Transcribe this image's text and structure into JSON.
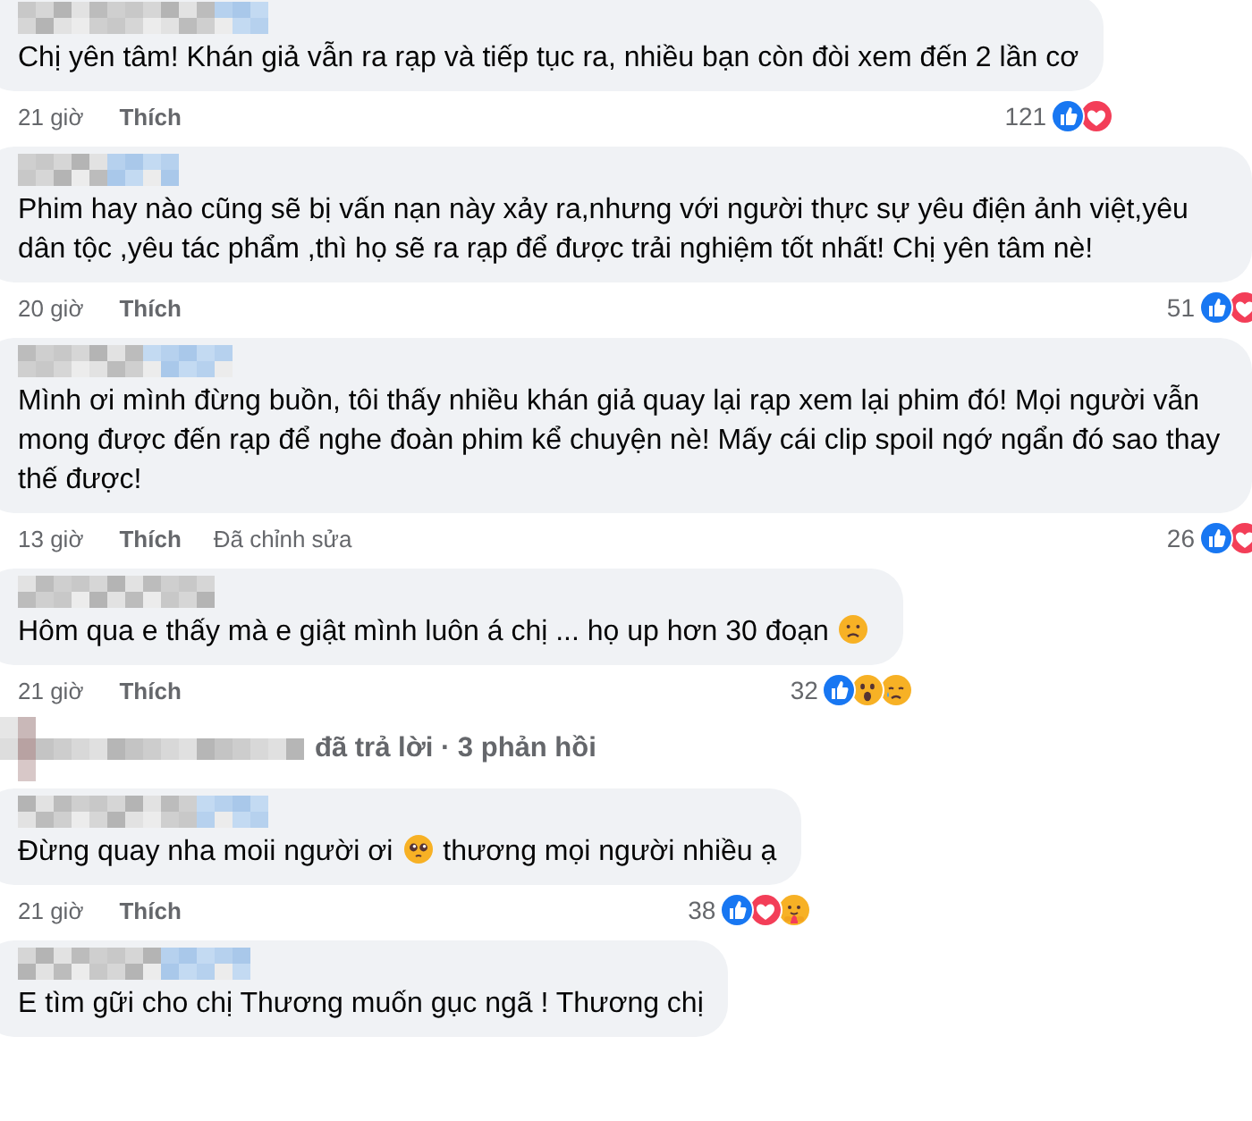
{
  "comments": [
    {
      "body": [
        {
          "kind": "text",
          "text": "Chị yên tâm! Khán giả vẫn ra rạp và tiếp tục ra, nhiều bạn còn đòi xem đến 2 lần cơ"
        }
      ],
      "time": "21 giờ",
      "like_label": "Thích",
      "reaction_count": "121",
      "reactions": [
        {
          "kind": "like"
        },
        {
          "kind": "love"
        }
      ]
    },
    {
      "body": [
        {
          "kind": "text",
          "text": "Phim hay nào cũng sẽ bị vấn nạn này xảy ra,nhưng với người thực sự yêu điện ảnh việt,yêu dân tộc ,yêu tác phẩm ,thì họ sẽ ra rạp để được trải nghiệm tốt nhất! Chị yên tâm nè!"
        }
      ],
      "time": "20 giờ",
      "like_label": "Thích",
      "reaction_count": "51",
      "reactions": [
        {
          "kind": "like"
        },
        {
          "kind": "love"
        }
      ]
    },
    {
      "body": [
        {
          "kind": "text",
          "text": "Mình ơi mình đừng buồn, tôi thấy nhiều khán giả quay lại rạp xem lại phim đó! Mọi người vẫn mong được đến rạp để nghe đoàn phim kể chuyện nè! Mấy cái clip spoil ngớ ngẩn đó sao thay thế được!"
        }
      ],
      "time": "13 giờ",
      "like_label": "Thích",
      "edited_label": "Đã chỉnh sửa",
      "reaction_count": "26",
      "reactions": [
        {
          "kind": "like"
        },
        {
          "kind": "love"
        }
      ]
    },
    {
      "body": [
        {
          "kind": "text",
          "text": "Hôm qua e thấy mà e giật mình luôn á chị ... họ up hơn 30 đoạn"
        },
        {
          "kind": "sad"
        }
      ],
      "time": "21 giờ",
      "like_label": "Thích",
      "reaction_count": "32",
      "reactions": [
        {
          "kind": "like"
        },
        {
          "kind": "wow"
        },
        {
          "kind": "cry"
        }
      ],
      "replies_label": "đã trả lời · 3 phản hồi"
    },
    {
      "body": [
        {
          "kind": "text",
          "text": "Đừng quay nha moii người ơi"
        },
        {
          "kind": "pleading"
        },
        {
          "kind": "text",
          "text": "thương mọi người nhiều ạ"
        }
      ],
      "time": "21 giờ",
      "like_label": "Thích",
      "reaction_count": "38",
      "reactions": [
        {
          "kind": "like"
        },
        {
          "kind": "love"
        },
        {
          "kind": "care"
        }
      ]
    },
    {
      "body": [
        {
          "kind": "text",
          "text": "E tìm gữi cho chị Thương muốn gục ngã ! Thương chị"
        }
      ]
    }
  ]
}
